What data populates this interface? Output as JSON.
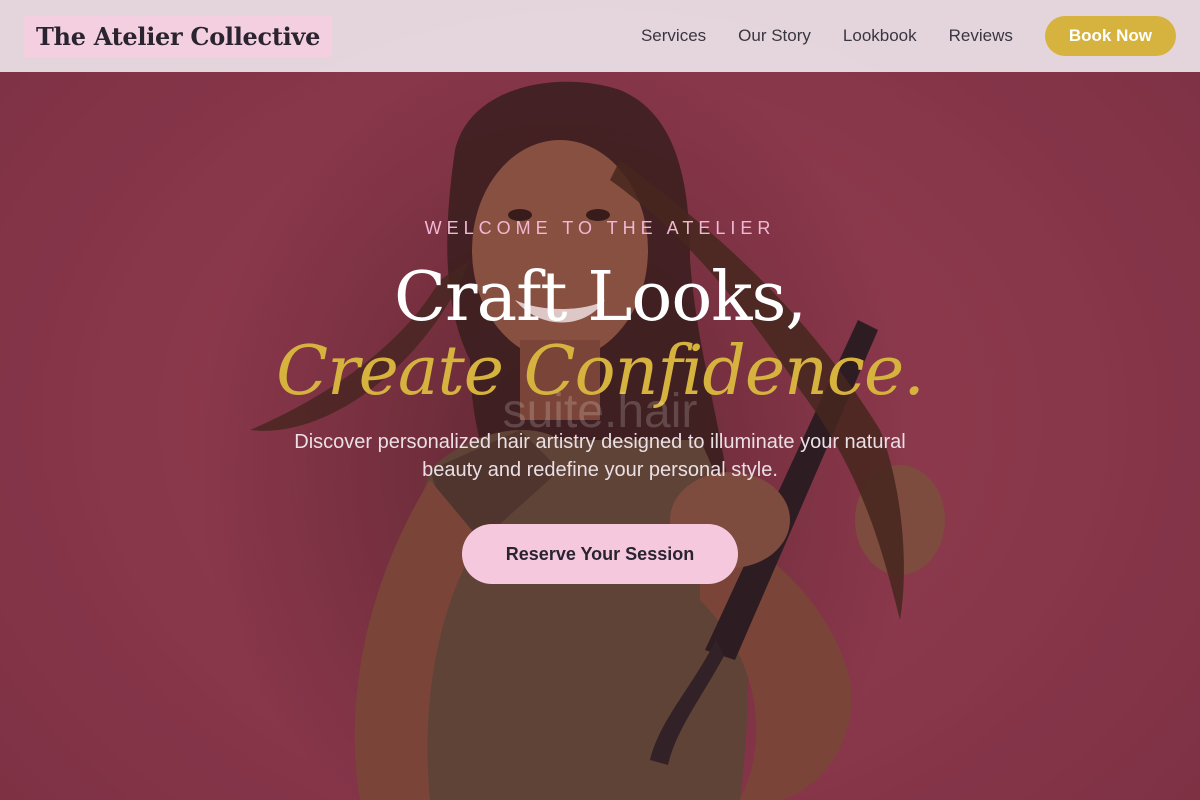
{
  "header": {
    "logo": "The Atelier Collective",
    "nav": [
      "Services",
      "Our Story",
      "Lookbook",
      "Reviews"
    ],
    "book_label": "Book Now"
  },
  "hero": {
    "eyebrow": "WELCOME TO THE ATELIER",
    "headline_line1": "Craft Looks,",
    "headline_line2": "Create Confidence.",
    "watermark": "suite.hair",
    "subtext": "Discover personalized hair artistry designed to illuminate your natural beauty and redefine your personal style.",
    "cta_label": "Reserve Your Session"
  },
  "colors": {
    "accent_gold": "#d6b23e",
    "accent_pink": "#f6c8de",
    "hero_bg": "#8f3a4e",
    "header_bg": "#ece2e8"
  },
  "icons": {
    "hero_image": "woman-straightening-hair-photo"
  }
}
